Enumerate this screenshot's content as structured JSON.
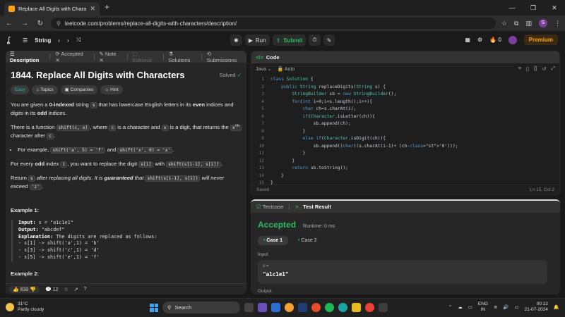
{
  "browser": {
    "tab_title": "Replace All Digits with Characte",
    "url": "leetcode.com/problems/replace-all-digits-with-characters/description/",
    "profile_initial": "S"
  },
  "nav": {
    "list_name": "String",
    "run": "Run",
    "submit": "Submit",
    "coins": "0",
    "premium": "Premium"
  },
  "left_tabs": [
    {
      "label": "Description"
    },
    {
      "label": "Accepted"
    },
    {
      "label": "Note"
    },
    {
      "label": "Editorial"
    },
    {
      "label": "Solutions"
    },
    {
      "label": "Submissions"
    }
  ],
  "problem": {
    "title": "1844. Replace All Digits with Characters",
    "status": "Solved",
    "chips": [
      "Easy",
      "Topics",
      "Companies",
      "Hint"
    ],
    "p1": {
      "a": "You are given a ",
      "b": "0-indexed",
      "c": " string ",
      "d": "s",
      "e": " that has lowercase English letters in its ",
      "f": "even",
      "g": " indices and digits in its ",
      "h": "odd",
      "i": " indices."
    },
    "p2": {
      "a": "There is a function ",
      "b": "shift(c, x)",
      "c": ", where ",
      "d": "c",
      "e": " is a character and ",
      "f": "x",
      "g": " is a digit, that returns the ",
      "h": "x",
      "i": "th",
      "j": " character after ",
      "k": "c",
      "l": "."
    },
    "bullet": {
      "a": "For example, ",
      "b": "shift('a', 5) = 'f'",
      "c": " and ",
      "d": "shift('x', 0) = 'x'",
      "e": "."
    },
    "p3": {
      "a": "For every ",
      "b": "odd",
      "c": " index ",
      "d": "i",
      "e": ", you want to replace the digit ",
      "f": "s[i]",
      "g": " with ",
      "h": "shift(s[i-1], s[i])",
      "i": "."
    },
    "p4": {
      "a": "Return ",
      "b": "s",
      "c": " after replacing all digits. It is ",
      "d": "guaranteed",
      "e": " that ",
      "f": "shift(s[i-1], s[i])",
      "g": " will never exceed ",
      "h": "'z'",
      "i": "."
    },
    "example1_title": "Example 1:",
    "example1": {
      "input_label": "Input:",
      "input_value": " s = \"a1c1e1\"",
      "output_label": "Output:",
      "output_value": " \"abcdef\"",
      "expl_label": "Explanation:",
      "expl_value": " The digits are replaced as follows:",
      "lines": [
        "- s[1] -> shift('a',1) = 'b'",
        "- s[3] -> shift('c',1) = 'd'",
        "- s[5] -> shift('e',1) = 'f'"
      ]
    },
    "example2_title": "Example 2:",
    "likes": "830",
    "comments": "12"
  },
  "code_panel": {
    "title": "Code",
    "language": "Java",
    "mode": "Auto",
    "lines": [
      "class Solution {",
      "    public String replaceDigits(String s) {",
      "        StringBuilder sb = new StringBuilder();",
      "        for(int i=0;i<s.length();i++){",
      "            char ch=s.charAt(i);",
      "            if(Character.isLetter(ch)){",
      "                sb.append(ch);",
      "            }",
      "            else if(Character.isDigit(ch)){",
      "                sb.append((char)(s.charAt(i-1)+ (ch-'0')));",
      "            }",
      "        }",
      "        return sb.toString();",
      "    }",
      "}"
    ],
    "saved": "Saved",
    "cursor": "Ln 15, Col 2"
  },
  "result": {
    "tab_testcase": "Testcase",
    "tab_result": "Test Result",
    "verdict": "Accepted",
    "runtime": "Runtime: 0 ms",
    "cases": [
      "Case 1",
      "Case 2"
    ],
    "input_label": "Input",
    "var_label": "s =",
    "var_value": "\"a1c1e1\"",
    "output_label": "Output"
  },
  "taskbar": {
    "temp": "31°C",
    "weather": "Partly cloudy",
    "search": "Search",
    "lang1": "ENG",
    "lang2": "IN",
    "time": "00:12",
    "date": "21-07-2024"
  }
}
